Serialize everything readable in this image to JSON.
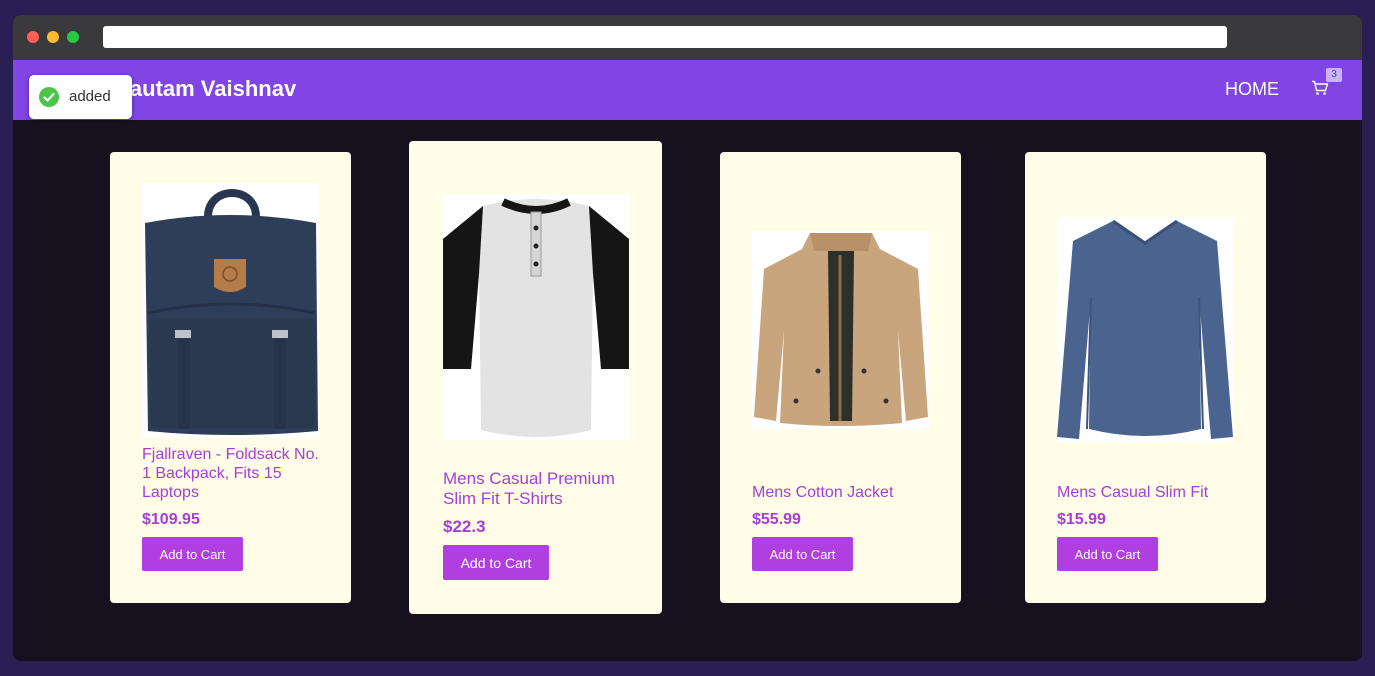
{
  "window": {
    "url": ""
  },
  "navbar": {
    "brand": "by Gautam Vaishnav",
    "home_label": "HOME",
    "cart_count": "3"
  },
  "toast": {
    "message": "added",
    "icon": "check-circle-icon"
  },
  "products": [
    {
      "title": "Fjallraven - Foldsack No. 1 Backpack, Fits 15 Laptops",
      "price": "$109.95",
      "button": "Add to Cart",
      "image": "backpack"
    },
    {
      "title": "Mens Casual Premium Slim Fit T-Shirts",
      "price": "$22.3",
      "button": "Add to Cart",
      "image": "raglan-henley-shirt"
    },
    {
      "title": "Mens Cotton Jacket",
      "price": "$55.99",
      "button": "Add to Cart",
      "image": "cotton-jacket"
    },
    {
      "title": "Mens Casual Slim Fit",
      "price": "$15.99",
      "button": "Add to Cart",
      "image": "long-sleeve-tee"
    }
  ],
  "colors": {
    "navbar": "#8144e5",
    "accent": "#a53fd6",
    "button": "#b03ee0",
    "card": "#fffce8",
    "background": "#16111f"
  }
}
